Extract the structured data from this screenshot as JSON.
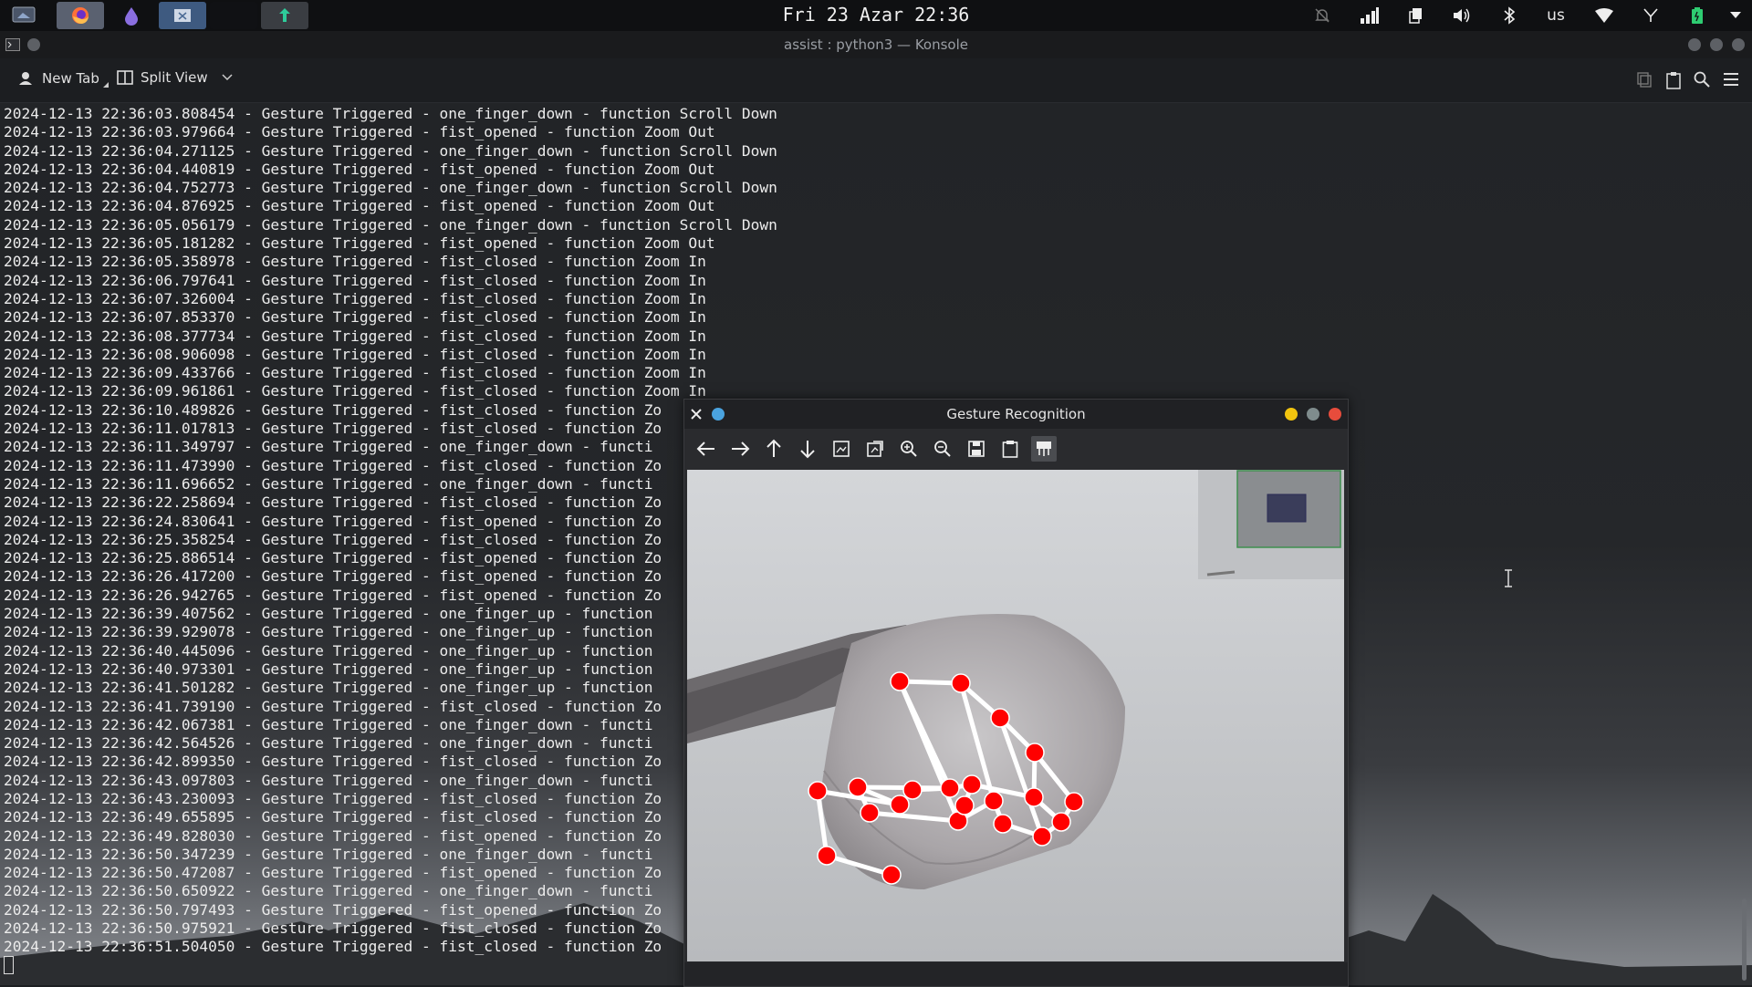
{
  "panel": {
    "clock": "Fri 23 Azar 22:36",
    "keyboard_layout": "us",
    "launcher_icons": [
      "desktop-icon",
      "firefox-icon",
      "app-icon",
      "window-icon",
      "empty-slot",
      "terminal-icon"
    ],
    "tray_icons": [
      "notifications-muted-icon",
      "network-signal-icon",
      "clipboard-icon",
      "volume-icon",
      "bluetooth-icon",
      "keyboard-layout",
      "wifi-icon",
      "vpn-icon",
      "battery-icon",
      "chevron-down-icon"
    ]
  },
  "konsole": {
    "title": "assist : python3 — Konsole",
    "new_tab": "New Tab",
    "split_view": "Split View",
    "log_lines": [
      "2024-12-13 22:36:03.808454 - Gesture Triggered - one_finger_down - function Scroll Down",
      "2024-12-13 22:36:03.979664 - Gesture Triggered - fist_opened - function Zoom Out",
      "2024-12-13 22:36:04.271125 - Gesture Triggered - one_finger_down - function Scroll Down",
      "2024-12-13 22:36:04.440819 - Gesture Triggered - fist_opened - function Zoom Out",
      "2024-12-13 22:36:04.752773 - Gesture Triggered - one_finger_down - function Scroll Down",
      "2024-12-13 22:36:04.876925 - Gesture Triggered - fist_opened - function Zoom Out",
      "2024-12-13 22:36:05.056179 - Gesture Triggered - one_finger_down - function Scroll Down",
      "2024-12-13 22:36:05.181282 - Gesture Triggered - fist_opened - function Zoom Out",
      "2024-12-13 22:36:05.358978 - Gesture Triggered - fist_closed - function Zoom In",
      "2024-12-13 22:36:06.797641 - Gesture Triggered - fist_closed - function Zoom In",
      "2024-12-13 22:36:07.326004 - Gesture Triggered - fist_closed - function Zoom In",
      "2024-12-13 22:36:07.853370 - Gesture Triggered - fist_closed - function Zoom In",
      "2024-12-13 22:36:08.377734 - Gesture Triggered - fist_closed - function Zoom In",
      "2024-12-13 22:36:08.906098 - Gesture Triggered - fist_closed - function Zoom In",
      "2024-12-13 22:36:09.433766 - Gesture Triggered - fist_closed - function Zoom In",
      "2024-12-13 22:36:09.961861 - Gesture Triggered - fist_closed - function Zoom In",
      "2024-12-13 22:36:10.489826 - Gesture Triggered - fist_closed - function Zo",
      "2024-12-13 22:36:11.017813 - Gesture Triggered - fist_closed - function Zo",
      "2024-12-13 22:36:11.349797 - Gesture Triggered - one_finger_down - functi",
      "2024-12-13 22:36:11.473990 - Gesture Triggered - fist_closed - function Zo",
      "2024-12-13 22:36:11.696652 - Gesture Triggered - one_finger_down - functi",
      "2024-12-13 22:36:22.258694 - Gesture Triggered - fist_closed - function Zo",
      "2024-12-13 22:36:24.830641 - Gesture Triggered - fist_opened - function Zo",
      "2024-12-13 22:36:25.358254 - Gesture Triggered - fist_closed - function Zo",
      "2024-12-13 22:36:25.886514 - Gesture Triggered - fist_opened - function Zo",
      "2024-12-13 22:36:26.417200 - Gesture Triggered - fist_opened - function Zo",
      "2024-12-13 22:36:26.942765 - Gesture Triggered - fist_opened - function Zo",
      "2024-12-13 22:36:39.407562 - Gesture Triggered - one_finger_up - function",
      "2024-12-13 22:36:39.929078 - Gesture Triggered - one_finger_up - function",
      "2024-12-13 22:36:40.445096 - Gesture Triggered - one_finger_up - function",
      "2024-12-13 22:36:40.973301 - Gesture Triggered - one_finger_up - function",
      "2024-12-13 22:36:41.501282 - Gesture Triggered - one_finger_up - function",
      "2024-12-13 22:36:41.739190 - Gesture Triggered - fist_closed - function Zo",
      "2024-12-13 22:36:42.067381 - Gesture Triggered - one_finger_down - functi",
      "2024-12-13 22:36:42.564526 - Gesture Triggered - one_finger_down - functi",
      "2024-12-13 22:36:42.899350 - Gesture Triggered - fist_closed - function Zo",
      "2024-12-13 22:36:43.097803 - Gesture Triggered - one_finger_down - functi",
      "2024-12-13 22:36:43.230093 - Gesture Triggered - fist_closed - function Zo",
      "2024-12-13 22:36:49.655895 - Gesture Triggered - fist_closed - function Zo",
      "2024-12-13 22:36:49.828030 - Gesture Triggered - fist_opened - function Zo",
      "2024-12-13 22:36:50.347239 - Gesture Triggered - one_finger_down - functi",
      "2024-12-13 22:36:50.472087 - Gesture Triggered - fist_opened - function Zo",
      "2024-12-13 22:36:50.650922 - Gesture Triggered - one_finger_down - functi",
      "2024-12-13 22:36:50.797493 - Gesture Triggered - fist_opened - function Zo",
      "2024-12-13 22:36:50.975921 - Gesture Triggered - fist_closed - function Zo",
      "2024-12-13 22:36:51.504050 - Gesture Triggered - fist_closed - function Zo"
    ]
  },
  "gesture_window": {
    "title": "Gesture Recognition",
    "toolbar_icons": [
      "back-icon",
      "forward-icon",
      "pan-up-icon",
      "pan-down-icon",
      "fit-image-icon",
      "save-as-icon",
      "zoom-in-icon",
      "zoom-out-icon",
      "save-icon",
      "copy-clipboard-icon",
      "properties-icon"
    ],
    "landmark_color": "#ff0000",
    "connection_color": "#ffffff"
  },
  "colors": {
    "panel_bg": "#0f1012",
    "terminal_text": "#ececec",
    "window_bg": "#1c1e21"
  }
}
